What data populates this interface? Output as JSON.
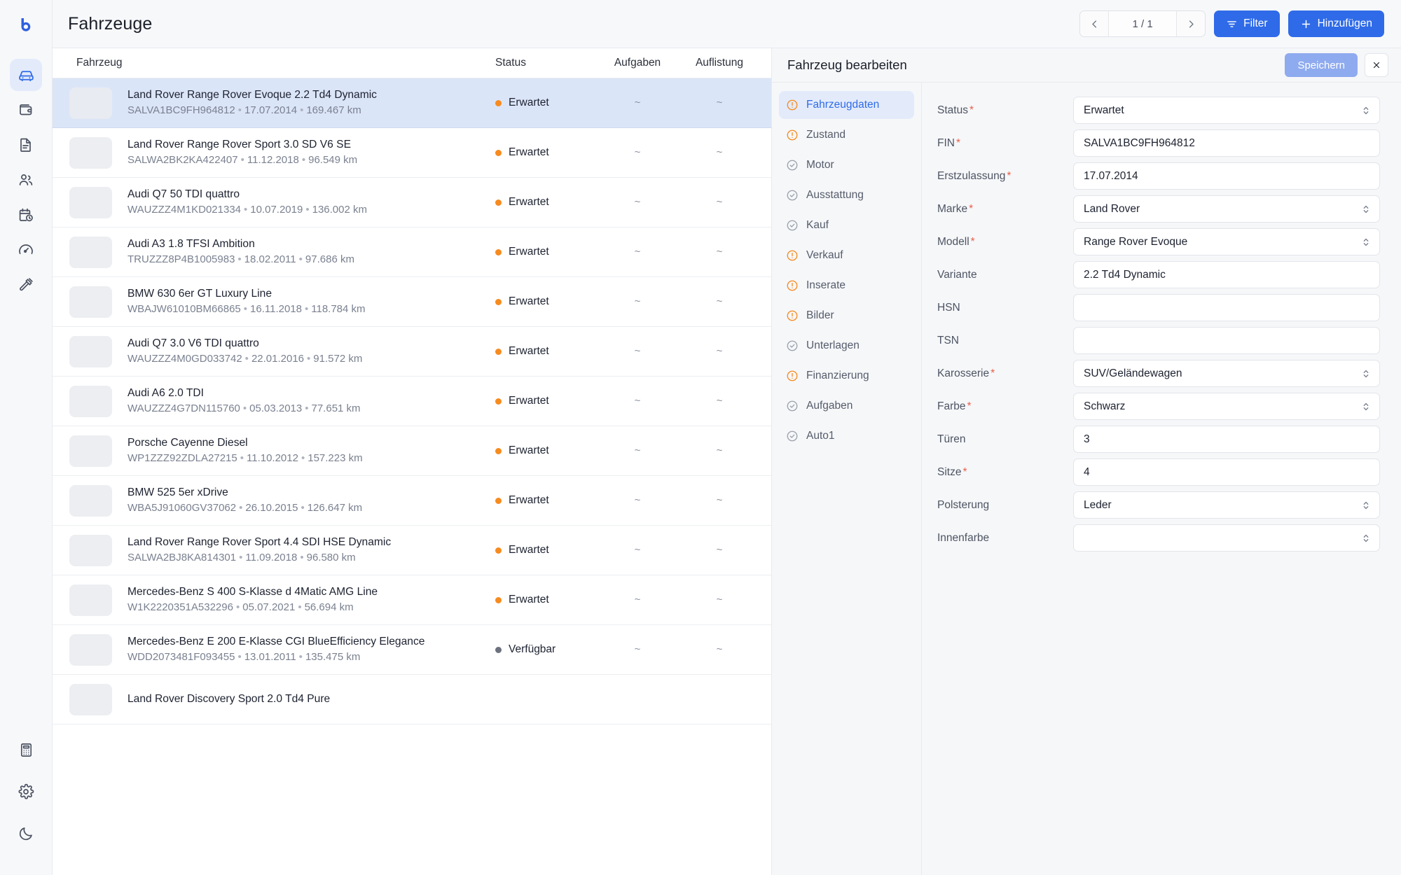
{
  "app": {
    "logo_icon": "brand-b-logo",
    "accent_color": "#2f6be8",
    "selected_row_color": "#dbe5f8",
    "status_expected_color": "#f68b1f",
    "status_available_color": "#6b717d",
    "required_color": "#e8604c"
  },
  "rail": {
    "items": [
      {
        "icon": "car-icon",
        "name": "vehicles",
        "active": true
      },
      {
        "icon": "wallet-icon",
        "name": "finance",
        "active": false
      },
      {
        "icon": "document-icon",
        "name": "documents",
        "active": false
      },
      {
        "icon": "users-icon",
        "name": "customers",
        "active": false
      },
      {
        "icon": "calendar-clock-icon",
        "name": "appointments",
        "active": false
      },
      {
        "icon": "gauge-icon",
        "name": "dashboard",
        "active": false
      },
      {
        "icon": "gavel-icon",
        "name": "auctions",
        "active": false
      }
    ],
    "bottom_items": [
      {
        "icon": "calculator-icon",
        "name": "calculator"
      },
      {
        "icon": "gear-icon",
        "name": "settings"
      },
      {
        "icon": "moon-icon",
        "name": "dark-mode"
      }
    ]
  },
  "header": {
    "title": "Fahrzeuge",
    "pagination": {
      "prev_icon": "chevron-left-icon",
      "label": "1 / 1",
      "next_icon": "chevron-right-icon"
    },
    "filter_button": {
      "label": "Filter",
      "icon": "filter-icon"
    },
    "add_button": {
      "label": "Hinzufügen",
      "icon": "plus-icon"
    }
  },
  "list": {
    "columns": {
      "vehicle": "Fahrzeug",
      "status": "Status",
      "tasks": "Aufgaben",
      "listing": "Auflistung"
    },
    "empty_cell": "~",
    "rows": [
      {
        "title": "Land Rover Range Rover Evoque 2.2 Td4 Dynamic",
        "vin": "SALVA1BC9FH964812",
        "date": "17.07.2014",
        "mileage": "169.467 km",
        "status": "Erwartet",
        "status_type": "expected",
        "tasks": "~",
        "listing": "~",
        "selected": true
      },
      {
        "title": "Land Rover Range Rover Sport 3.0 SD V6 SE",
        "vin": "SALWA2BK2KA422407",
        "date": "11.12.2018",
        "mileage": "96.549 km",
        "status": "Erwartet",
        "status_type": "expected",
        "tasks": "~",
        "listing": "~",
        "selected": false
      },
      {
        "title": "Audi Q7 50 TDI quattro",
        "vin": "WAUZZZ4M1KD021334",
        "date": "10.07.2019",
        "mileage": "136.002 km",
        "status": "Erwartet",
        "status_type": "expected",
        "tasks": "~",
        "listing": "~",
        "selected": false
      },
      {
        "title": "Audi A3 1.8 TFSI Ambition",
        "vin": "TRUZZZ8P4B1005983",
        "date": "18.02.2011",
        "mileage": "97.686 km",
        "status": "Erwartet",
        "status_type": "expected",
        "tasks": "~",
        "listing": "~",
        "selected": false
      },
      {
        "title": "BMW 630 6er GT Luxury Line",
        "vin": "WBAJW61010BM66865",
        "date": "16.11.2018",
        "mileage": "118.784 km",
        "status": "Erwartet",
        "status_type": "expected",
        "tasks": "~",
        "listing": "~",
        "selected": false
      },
      {
        "title": "Audi Q7 3.0 V6 TDI quattro",
        "vin": "WAUZZZ4M0GD033742",
        "date": "22.01.2016",
        "mileage": "91.572 km",
        "status": "Erwartet",
        "status_type": "expected",
        "tasks": "~",
        "listing": "~",
        "selected": false
      },
      {
        "title": "Audi A6 2.0 TDI",
        "vin": "WAUZZZ4G7DN115760",
        "date": "05.03.2013",
        "mileage": "77.651 km",
        "status": "Erwartet",
        "status_type": "expected",
        "tasks": "~",
        "listing": "~",
        "selected": false
      },
      {
        "title": "Porsche Cayenne Diesel",
        "vin": "WP1ZZZ92ZDLA27215",
        "date": "11.10.2012",
        "mileage": "157.223 km",
        "status": "Erwartet",
        "status_type": "expected",
        "tasks": "~",
        "listing": "~",
        "selected": false
      },
      {
        "title": "BMW 525 5er xDrive",
        "vin": "WBA5J91060GV37062",
        "date": "26.10.2015",
        "mileage": "126.647 km",
        "status": "Erwartet",
        "status_type": "expected",
        "tasks": "~",
        "listing": "~",
        "selected": false
      },
      {
        "title": "Land Rover Range Rover Sport 4.4 SDI HSE Dynamic",
        "vin": "SALWA2BJ8KA814301",
        "date": "11.09.2018",
        "mileage": "96.580 km",
        "status": "Erwartet",
        "status_type": "expected",
        "tasks": "~",
        "listing": "~",
        "selected": false
      },
      {
        "title": "Mercedes-Benz S 400 S-Klasse d 4Matic AMG Line",
        "vin": "W1K2220351A532296",
        "date": "05.07.2021",
        "mileage": "56.694 km",
        "status": "Erwartet",
        "status_type": "expected",
        "tasks": "~",
        "listing": "~",
        "selected": false
      },
      {
        "title": "Mercedes-Benz E 200 E-Klasse CGI BlueEfficiency Elegance",
        "vin": "WDD2073481F093455",
        "date": "13.01.2011",
        "mileage": "135.475 km",
        "status": "Verfügbar",
        "status_type": "available",
        "tasks": "~",
        "listing": "~",
        "selected": false
      },
      {
        "title": "Land Rover Discovery Sport 2.0 Td4 Pure",
        "vin": "",
        "date": "",
        "mileage": "",
        "status": "",
        "status_type": "none",
        "tasks": "",
        "listing": "",
        "selected": false
      }
    ]
  },
  "edit_panel": {
    "title": "Fahrzeug bearbeiten",
    "save_label": "Speichern",
    "close_icon": "close-icon",
    "nav": [
      {
        "label": "Fahrzeugdaten",
        "icon": "warning-circle-icon",
        "state": "warning",
        "active": true
      },
      {
        "label": "Zustand",
        "icon": "warning-circle-icon",
        "state": "warning",
        "active": false
      },
      {
        "label": "Motor",
        "icon": "check-circle-icon",
        "state": "done",
        "active": false
      },
      {
        "label": "Ausstattung",
        "icon": "check-circle-icon",
        "state": "done",
        "active": false
      },
      {
        "label": "Kauf",
        "icon": "check-circle-icon",
        "state": "done",
        "active": false
      },
      {
        "label": "Verkauf",
        "icon": "warning-circle-icon",
        "state": "warning",
        "active": false
      },
      {
        "label": "Inserate",
        "icon": "warning-circle-icon",
        "state": "warning",
        "active": false
      },
      {
        "label": "Bilder",
        "icon": "warning-circle-icon",
        "state": "warning",
        "active": false
      },
      {
        "label": "Unterlagen",
        "icon": "check-circle-icon",
        "state": "done",
        "active": false
      },
      {
        "label": "Finanzierung",
        "icon": "warning-circle-icon",
        "state": "warning",
        "active": false
      },
      {
        "label": "Aufgaben",
        "icon": "check-circle-icon",
        "state": "done",
        "active": false
      },
      {
        "label": "Auto1",
        "icon": "check-circle-icon",
        "state": "done",
        "active": false
      }
    ],
    "fields": [
      {
        "label": "Status",
        "required": true,
        "value": "Erwartet",
        "type": "select"
      },
      {
        "label": "FIN",
        "required": true,
        "value": "SALVA1BC9FH964812",
        "type": "text"
      },
      {
        "label": "Erstzulassung",
        "required": true,
        "value": "17.07.2014",
        "type": "text"
      },
      {
        "label": "Marke",
        "required": true,
        "value": "Land Rover",
        "type": "select"
      },
      {
        "label": "Modell",
        "required": true,
        "value": "Range Rover Evoque",
        "type": "select"
      },
      {
        "label": "Variante",
        "required": false,
        "value": "2.2 Td4 Dynamic",
        "type": "text"
      },
      {
        "label": "HSN",
        "required": false,
        "value": "",
        "type": "text"
      },
      {
        "label": "TSN",
        "required": false,
        "value": "",
        "type": "text"
      },
      {
        "label": "Karosserie",
        "required": true,
        "value": "SUV/Geländewagen",
        "type": "select"
      },
      {
        "label": "Farbe",
        "required": true,
        "value": "Schwarz",
        "type": "select"
      },
      {
        "label": "Türen",
        "required": false,
        "value": "3",
        "type": "text"
      },
      {
        "label": "Sitze",
        "required": true,
        "value": "4",
        "type": "text"
      },
      {
        "label": "Polsterung",
        "required": false,
        "value": "Leder",
        "type": "select"
      },
      {
        "label": "Innenfarbe",
        "required": false,
        "value": "",
        "type": "select"
      }
    ]
  }
}
